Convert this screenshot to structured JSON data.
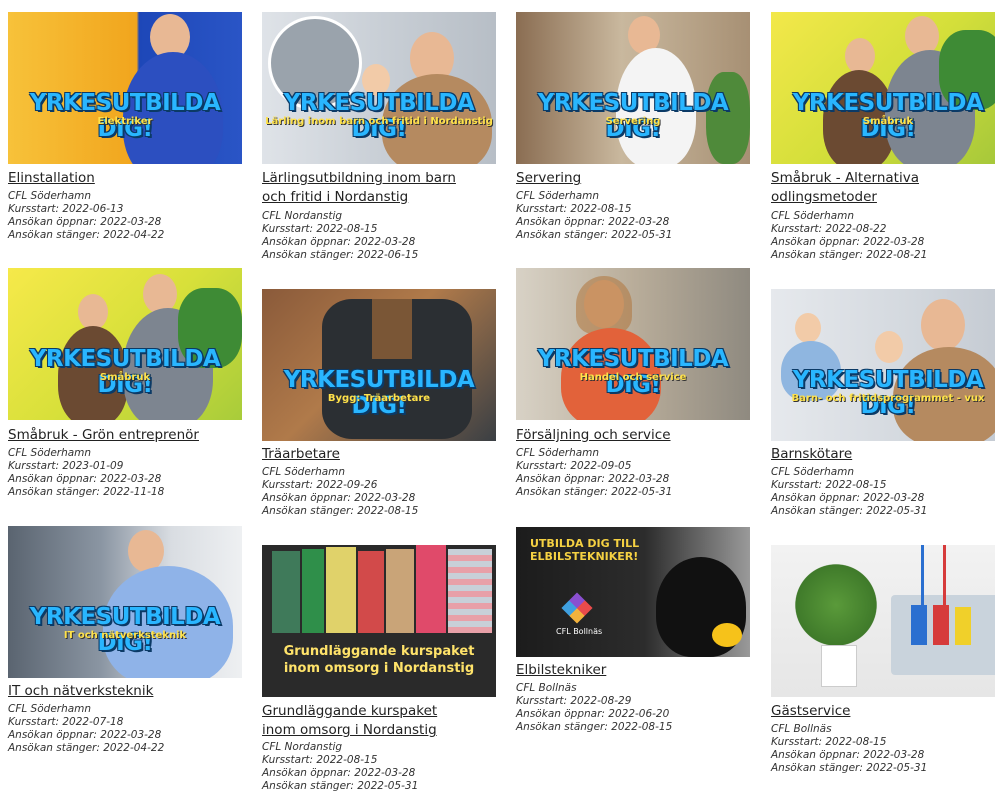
{
  "banner": "YRKESUTBILDA DIG!",
  "courses": [
    {
      "title_lines": [
        "Elinstallation"
      ],
      "subtitle": "Elektriker",
      "provider": "CFL Söderhamn",
      "start": "Kursstart: 2022-06-13",
      "open": "Ansökan öppnar: 2022-03-28",
      "close": "Ansökan stänger: 2022-04-22"
    },
    {
      "title_lines": [
        "Lärlingsutbildning inom barn",
        "och fritid i Nordanstig"
      ],
      "subtitle": "Lärling inom barn och fritid i Nordanstig",
      "provider": "CFL Nordanstig",
      "start": "Kursstart: 2022-08-15",
      "open": "Ansökan öppnar: 2022-03-28",
      "close": "Ansökan stänger: 2022-06-15"
    },
    {
      "title_lines": [
        "Servering"
      ],
      "subtitle": "Servering",
      "provider": "CFL Söderhamn",
      "start": "Kursstart: 2022-08-15",
      "open": "Ansökan öppnar: 2022-03-28",
      "close": "Ansökan stänger: 2022-05-31"
    },
    {
      "title_lines": [
        "Småbruk - Alternativa",
        "odlingsmetoder"
      ],
      "subtitle": "Småbruk",
      "provider": "CFL Söderhamn",
      "start": "Kursstart: 2022-08-22",
      "open": "Ansökan öppnar: 2022-03-28",
      "close": "Ansökan stänger: 2022-08-21"
    },
    {
      "title_lines": [
        "Småbruk - Grön entreprenör"
      ],
      "subtitle": "Småbruk",
      "provider": "CFL Söderhamn",
      "start": "Kursstart: 2023-01-09",
      "open": "Ansökan öppnar: 2022-03-28",
      "close": "Ansökan stänger: 2022-11-18"
    },
    {
      "title_lines": [
        "Träarbetare"
      ],
      "subtitle": "Bygg: Träarbetare",
      "provider": "CFL Söderhamn",
      "start": "Kursstart: 2022-09-26",
      "open": "Ansökan öppnar: 2022-03-28",
      "close": "Ansökan stänger: 2022-08-15"
    },
    {
      "title_lines": [
        "Försäljning och service"
      ],
      "subtitle": "Handel och service",
      "provider": "CFL Söderhamn",
      "start": "Kursstart: 2022-09-05",
      "open": "Ansökan öppnar: 2022-03-28",
      "close": "Ansökan stänger: 2022-05-31"
    },
    {
      "title_lines": [
        "Barnskötare"
      ],
      "subtitle": "Barn- och fritidsprogrammet - vux",
      "provider": "CFL Söderhamn",
      "start": "Kursstart: 2022-08-15",
      "open": "Ansökan öppnar: 2022-03-28",
      "close": "Ansökan stänger: 2022-05-31"
    },
    {
      "title_lines": [
        "IT och nätverksteknik"
      ],
      "subtitle": "IT och nätverksteknik",
      "provider": "CFL Söderhamn",
      "start": "Kursstart: 2022-07-18",
      "open": "Ansökan öppnar: 2022-03-28",
      "close": "Ansökan stänger: 2022-04-22"
    },
    {
      "title_lines": [
        "Grundläggande kurspaket",
        "inom omsorg i Nordanstig"
      ],
      "image_text": "Grundläggande kurspaket inom omsorg i Nordanstig",
      "provider": "CFL Nordanstig",
      "start": "Kursstart: 2022-08-15",
      "open": "Ansökan öppnar: 2022-03-28",
      "close": "Ansökan stänger: 2022-05-31"
    },
    {
      "title_lines": [
        "Elbilstekniker"
      ],
      "image_text": "UTBILDA DIG TILL ELBILSTEKNIKER!",
      "image_logo": "CFL Bollnäs",
      "provider": "CFL Bollnäs",
      "start": "Kursstart: 2022-08-29",
      "open": "Ansökan öppnar: 2022-06-20",
      "close": "Ansökan stänger: 2022-08-15"
    },
    {
      "title_lines": [
        "Gästservice"
      ],
      "provider": "CFL Bollnäs",
      "start": "Kursstart: 2022-08-15",
      "open": "Ansökan öppnar: 2022-03-28",
      "close": "Ansökan stänger: 2022-05-31"
    }
  ]
}
